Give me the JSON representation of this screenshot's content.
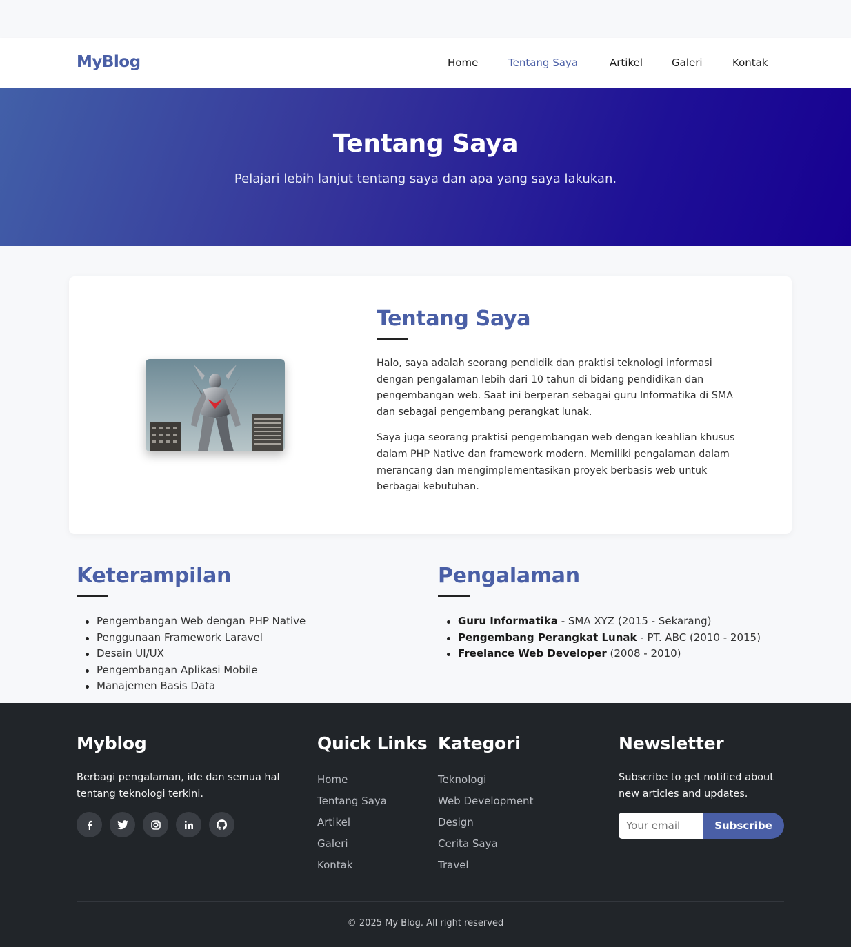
{
  "navbar": {
    "brand": "MyBlog",
    "links": [
      "Home",
      "Tentang Saya",
      "Artikel",
      "Galeri",
      "Kontak"
    ],
    "active": "Tentang Saya"
  },
  "hero": {
    "title": "Tentang Saya",
    "subtitle": "Pelajari lebih lanjut tentang saya dan apa yang saya lakukan."
  },
  "about": {
    "title": "Tentang Saya",
    "paragraphs": [
      "Halo, saya adalah seorang pendidik dan praktisi teknologi informasi dengan pengalaman lebih dari 10 tahun di bidang pendidikan dan pengembangan web. Saat ini berperan sebagai guru Informatika di SMA dan sebagai pengembang perangkat lunak.",
      "Saya juga seorang praktisi pengembangan web dengan keahlian khusus dalam PHP Native dan framework modern. Memiliki pengalaman dalam merancang dan mengimplementasikan proyek berbasis web untuk berbagai kebutuhan."
    ]
  },
  "skills": {
    "title": "Keterampilan",
    "items": [
      "Pengembangan Web dengan PHP Native",
      "Penggunaan Framework Laravel",
      "Desain UI/UX",
      "Pengembangan Aplikasi Mobile",
      "Manajemen Basis Data"
    ]
  },
  "experience": {
    "title": "Pengalaman",
    "items": [
      {
        "role": "Guru Informatika",
        "detail": " - SMA XYZ (2015 - Sekarang)"
      },
      {
        "role": "Pengembang Perangkat Lunak",
        "detail": " - PT. ABC (2010 - 2015)"
      },
      {
        "role": "Freelance Web Developer",
        "detail": " (2008 - 2010)"
      }
    ]
  },
  "footer": {
    "brand": {
      "title": "Myblog",
      "line1": "Berbagi pengalaman, ide dan semua hal",
      "line2": "tentang teknologi terkini."
    },
    "quick_links": {
      "title": "Quick Links",
      "items": [
        "Home",
        "Tentang Saya",
        "Artikel",
        "Galeri",
        "Kontak"
      ]
    },
    "categories": {
      "title": "Kategori",
      "items": [
        "Teknologi",
        "Web Development",
        "Design",
        "Cerita Saya",
        "Travel"
      ]
    },
    "newsletter": {
      "title": "Newsletter",
      "line1": "Subscribe to get notified about",
      "line2": "new articles and updates.",
      "placeholder": "Your email",
      "button": "Subscribe"
    },
    "socials": [
      "facebook-icon",
      "twitter-icon",
      "instagram-icon",
      "linkedin-icon",
      "github-icon"
    ],
    "copyright": "© 2025 My Blog. All right reserved"
  },
  "colors": {
    "accent": "#4a5fa6",
    "hero_start": "#4260a8",
    "hero_end": "#170091",
    "footer_bg": "#212529"
  }
}
